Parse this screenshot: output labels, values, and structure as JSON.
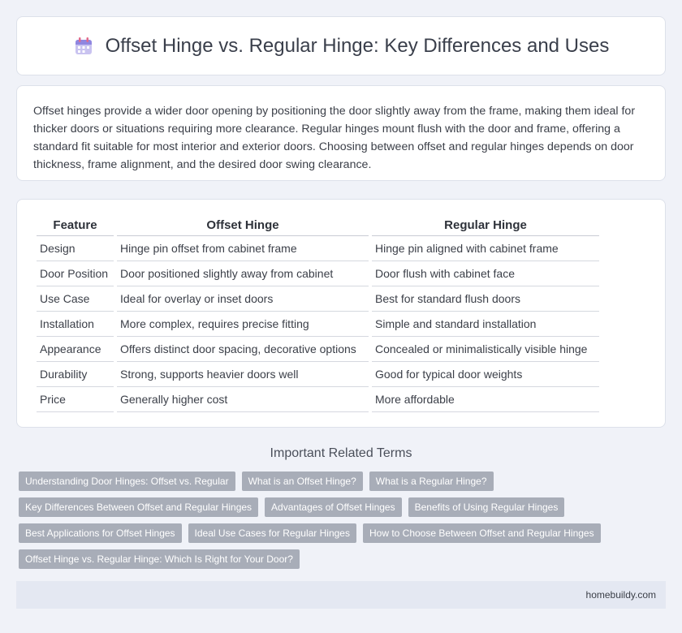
{
  "header": {
    "title": "Offset Hinge vs. Regular Hinge: Key Differences and Uses",
    "icon": "calendar-icon"
  },
  "intro": {
    "text": "Offset hinges provide a wider door opening by positioning the door slightly away from the frame, making them ideal for thicker doors or situations requiring more clearance. Regular hinges mount flush with the door and frame, offering a standard fit suitable for most interior and exterior doors. Choosing between offset and regular hinges depends on door thickness, frame alignment, and the desired door swing clearance."
  },
  "table": {
    "headers": [
      "Feature",
      "Offset Hinge",
      "Regular Hinge"
    ],
    "rows": [
      [
        "Design",
        "Hinge pin offset from cabinet frame",
        "Hinge pin aligned with cabinet frame"
      ],
      [
        "Door Position",
        "Door positioned slightly away from cabinet",
        "Door flush with cabinet face"
      ],
      [
        "Use Case",
        "Ideal for overlay or inset doors",
        "Best for standard flush doors"
      ],
      [
        "Installation",
        "More complex, requires precise fitting",
        "Simple and standard installation"
      ],
      [
        "Appearance",
        "Offers distinct door spacing, decorative options",
        "Concealed or minimalistically visible hinge"
      ],
      [
        "Durability",
        "Strong, supports heavier doors well",
        "Good for typical door weights"
      ],
      [
        "Price",
        "Generally higher cost",
        "More affordable"
      ]
    ]
  },
  "related": {
    "title": "Important Related Terms",
    "tags": [
      "Understanding Door Hinges: Offset vs. Regular",
      "What is an Offset Hinge?",
      "What is a Regular Hinge?",
      "Key Differences Between Offset and Regular Hinges",
      "Advantages of Offset Hinges",
      "Benefits of Using Regular Hinges",
      "Best Applications for Offset Hinges",
      "Ideal Use Cases for Regular Hinges",
      "How to Choose Between Offset and Regular Hinges",
      "Offset Hinge vs. Regular Hinge: Which Is Right for Your Door?"
    ]
  },
  "footer": {
    "site": "homebuildy.com"
  },
  "colors": {
    "background": "#f0f2f8",
    "tag_background": "#a8adb8",
    "footer_background": "#e4e8f2"
  }
}
